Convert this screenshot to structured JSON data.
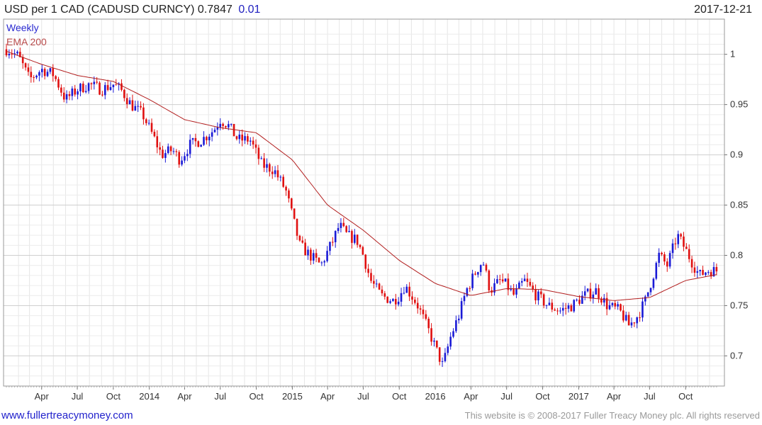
{
  "header": {
    "title": "USD per 1 CAD (CADUSD CURNCY) 0.7847",
    "change": "0.01",
    "date": "2017-12-21"
  },
  "legend": {
    "period": "Weekly",
    "indicator": "EMA 200"
  },
  "footer": {
    "link": "www.fullertreacymoney.com",
    "copyright": "This website is © 2008-2017 Fuller Treacy Money plc. All rights reserved"
  },
  "colors": {
    "up_candle": "#1a1ad6",
    "down_candle": "#e01010",
    "ema_line": "#b21e1e",
    "grid": "#cfcfcf"
  },
  "chart_data": {
    "type": "candlestick",
    "title": "USD per 1 CAD (CADUSD CURNCY) 0.7847",
    "series": [
      {
        "name": "Weekly",
        "type": "candlestick",
        "representation": "weekly OHLC candles (approximate closes listed)"
      },
      {
        "name": "EMA 200",
        "type": "line"
      }
    ],
    "y_axis": {
      "side": "right",
      "min": 0.67,
      "max": 1.035,
      "ticks": [
        1,
        0.95,
        0.9,
        0.85,
        0.8,
        0.75,
        0.7
      ]
    },
    "x_axis": {
      "min": "2013-01-01",
      "max": "2017-12-21",
      "ticks": [
        {
          "date": "2013-04-01",
          "label": "Apr"
        },
        {
          "date": "2013-07-01",
          "label": "Jul"
        },
        {
          "date": "2013-10-01",
          "label": "Oct"
        },
        {
          "date": "2014-01-01",
          "label": "2014"
        },
        {
          "date": "2014-04-01",
          "label": "Apr"
        },
        {
          "date": "2014-07-01",
          "label": "Jul"
        },
        {
          "date": "2014-10-01",
          "label": "Oct"
        },
        {
          "date": "2015-01-01",
          "label": "2015"
        },
        {
          "date": "2015-04-01",
          "label": "Apr"
        },
        {
          "date": "2015-07-01",
          "label": "Jul"
        },
        {
          "date": "2015-10-01",
          "label": "Oct"
        },
        {
          "date": "2016-01-01",
          "label": "2016"
        },
        {
          "date": "2016-04-01",
          "label": "Apr"
        },
        {
          "date": "2016-07-01",
          "label": "Jul"
        },
        {
          "date": "2016-10-01",
          "label": "Oct"
        },
        {
          "date": "2017-01-01",
          "label": "2017"
        },
        {
          "date": "2017-04-01",
          "label": "Apr"
        },
        {
          "date": "2017-07-01",
          "label": "Jul"
        },
        {
          "date": "2017-10-01",
          "label": "Oct"
        }
      ]
    },
    "price_closes": [
      [
        "2013-01-04",
        1.005
      ],
      [
        "2013-02-01",
        0.998
      ],
      [
        "2013-03-01",
        0.975
      ],
      [
        "2013-04-01",
        0.985
      ],
      [
        "2013-05-01",
        0.98
      ],
      [
        "2013-06-01",
        0.955
      ],
      [
        "2013-07-01",
        0.965
      ],
      [
        "2013-08-01",
        0.97
      ],
      [
        "2013-09-01",
        0.965
      ],
      [
        "2013-10-01",
        0.97
      ],
      [
        "2013-10-20",
        0.965
      ],
      [
        "2013-11-15",
        0.95
      ],
      [
        "2013-12-15",
        0.94
      ],
      [
        "2014-01-15",
        0.915
      ],
      [
        "2014-02-01",
        0.9
      ],
      [
        "2014-03-01",
        0.905
      ],
      [
        "2014-03-20",
        0.895
      ],
      [
        "2014-04-15",
        0.91
      ],
      [
        "2014-05-15",
        0.915
      ],
      [
        "2014-06-15",
        0.925
      ],
      [
        "2014-07-01",
        0.935
      ],
      [
        "2014-07-20",
        0.93
      ],
      [
        "2014-08-15",
        0.915
      ],
      [
        "2014-09-15",
        0.915
      ],
      [
        "2014-10-15",
        0.89
      ],
      [
        "2014-11-15",
        0.885
      ],
      [
        "2014-12-15",
        0.865
      ],
      [
        "2015-01-20",
        0.81
      ],
      [
        "2015-02-15",
        0.8
      ],
      [
        "2015-03-15",
        0.79
      ],
      [
        "2015-04-15",
        0.815
      ],
      [
        "2015-05-01",
        0.83
      ],
      [
        "2015-05-20",
        0.82
      ],
      [
        "2015-06-15",
        0.815
      ],
      [
        "2015-07-01",
        0.8
      ],
      [
        "2015-07-20",
        0.775
      ],
      [
        "2015-08-15",
        0.76
      ],
      [
        "2015-09-15",
        0.755
      ],
      [
        "2015-10-01",
        0.76
      ],
      [
        "2015-10-15",
        0.77
      ],
      [
        "2015-11-15",
        0.752
      ],
      [
        "2015-12-15",
        0.725
      ],
      [
        "2016-01-20",
        0.69
      ],
      [
        "2016-02-10",
        0.72
      ],
      [
        "2016-03-01",
        0.74
      ],
      [
        "2016-03-20",
        0.765
      ],
      [
        "2016-04-15",
        0.785
      ],
      [
        "2016-05-01",
        0.795
      ],
      [
        "2016-05-20",
        0.765
      ],
      [
        "2016-06-15",
        0.775
      ],
      [
        "2016-07-01",
        0.77
      ],
      [
        "2016-07-20",
        0.76
      ],
      [
        "2016-08-15",
        0.775
      ],
      [
        "2016-09-15",
        0.76
      ],
      [
        "2016-10-15",
        0.75
      ],
      [
        "2016-11-15",
        0.745
      ],
      [
        "2016-12-15",
        0.75
      ],
      [
        "2017-01-15",
        0.76
      ],
      [
        "2017-02-15",
        0.765
      ],
      [
        "2017-03-15",
        0.75
      ],
      [
        "2017-04-15",
        0.745
      ],
      [
        "2017-05-10",
        0.73
      ],
      [
        "2017-06-01",
        0.74
      ],
      [
        "2017-06-20",
        0.755
      ],
      [
        "2017-07-10",
        0.78
      ],
      [
        "2017-07-25",
        0.8
      ],
      [
        "2017-08-15",
        0.79
      ],
      [
        "2017-09-10",
        0.82
      ],
      [
        "2017-09-25",
        0.81
      ],
      [
        "2017-10-15",
        0.795
      ],
      [
        "2017-11-05",
        0.78
      ],
      [
        "2017-11-25",
        0.785
      ],
      [
        "2017-12-21",
        0.7847
      ]
    ],
    "ema_200": [
      [
        "2013-01-01",
        1.003
      ],
      [
        "2013-04-01",
        0.99
      ],
      [
        "2013-07-01",
        0.979
      ],
      [
        "2013-10-01",
        0.973
      ],
      [
        "2014-01-01",
        0.955
      ],
      [
        "2014-04-01",
        0.935
      ],
      [
        "2014-07-01",
        0.927
      ],
      [
        "2014-10-01",
        0.922
      ],
      [
        "2015-01-01",
        0.895
      ],
      [
        "2015-04-01",
        0.85
      ],
      [
        "2015-07-01",
        0.825
      ],
      [
        "2015-10-01",
        0.795
      ],
      [
        "2016-01-01",
        0.772
      ],
      [
        "2016-04-01",
        0.76
      ],
      [
        "2016-07-01",
        0.767
      ],
      [
        "2016-10-01",
        0.766
      ],
      [
        "2017-01-01",
        0.759
      ],
      [
        "2017-04-01",
        0.755
      ],
      [
        "2017-07-01",
        0.758
      ],
      [
        "2017-10-01",
        0.775
      ],
      [
        "2017-12-21",
        0.781
      ]
    ]
  }
}
